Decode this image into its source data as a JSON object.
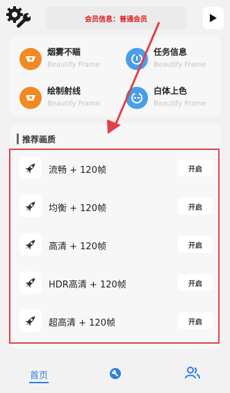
{
  "header": {
    "settings_icon": "gear-wrench-icon",
    "member_info": "会员信息：普通会员",
    "play_icon": "play-icon"
  },
  "features": [
    {
      "title": "烟雾不瞄",
      "subtitle": "Beautify Frame",
      "icon": "orange-frame-icon"
    },
    {
      "title": "任务信息",
      "subtitle": "Beautify Frame",
      "icon": "blue-info-icon"
    },
    {
      "title": "绘制射线",
      "subtitle": "Beautify Frame",
      "icon": "orange-frame-icon"
    },
    {
      "title": "白体上色",
      "subtitle": "Beautify Frame",
      "icon": "blue-info-icon"
    }
  ],
  "quality": {
    "section_title": "推荐画质",
    "items": [
      {
        "label": "流畅 + 120帧",
        "button": "开启"
      },
      {
        "label": "均衡 + 120帧",
        "button": "开启"
      },
      {
        "label": "高清 + 120帧",
        "button": "开启"
      },
      {
        "label": "HDR高清 + 120帧",
        "button": "开启"
      },
      {
        "label": "超高清 + 120帧",
        "button": "开启"
      }
    ]
  },
  "nav": {
    "home_label": "首页",
    "tool_icon": "wrench-icon",
    "user_icon": "users-icon"
  },
  "colors": {
    "accent": "#2f7de1",
    "member_text": "#e02020",
    "annotation": "#e2404a",
    "orange": "#f08a24",
    "blue": "#4a9ee8"
  }
}
